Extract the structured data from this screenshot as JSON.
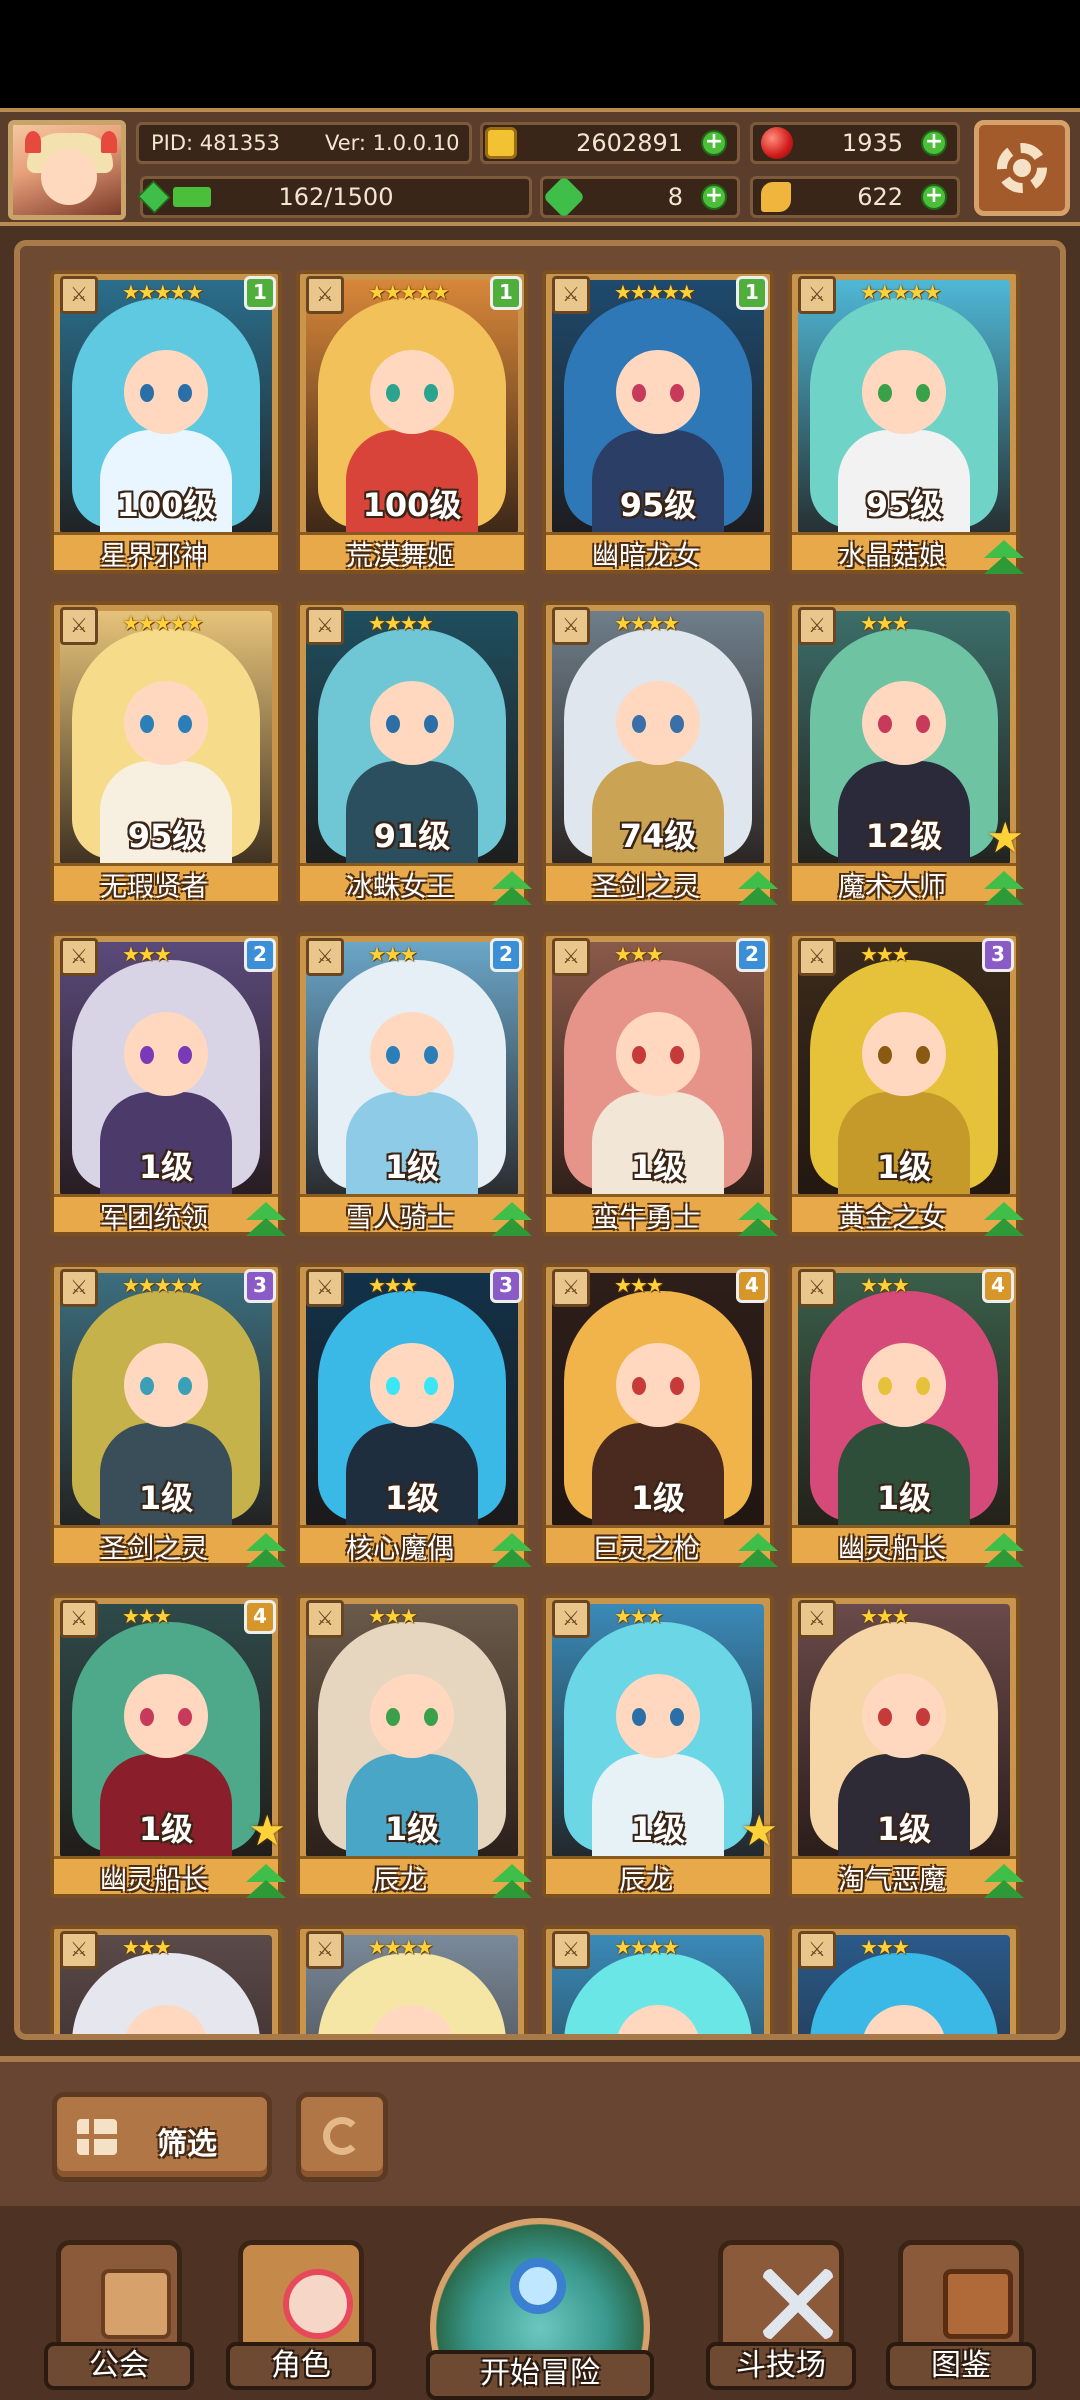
{
  "hud": {
    "pid": "PID: 481353",
    "ver": "Ver: 1.0.0.10",
    "gold": "2602891",
    "red_gem": "1935",
    "energy": "162/1500",
    "energy_fraction": 0.108,
    "clover": "8",
    "scroll": "622"
  },
  "cards": [
    {
      "name": "星界邪神",
      "level": "100级",
      "stars": "★★★★★",
      "badge": "1",
      "badge_color": "#4fae3c",
      "hair": "#5ec9e0",
      "body": "#eaf6ff",
      "bg": "#2a6e8c",
      "eye": "#2b6fa8",
      "star_icon": false,
      "up_icon": false
    },
    {
      "name": "荒漠舞姬",
      "level": "100级",
      "stars": "★★★★★",
      "badge": "1",
      "badge_color": "#4fae3c",
      "hair": "#f3c15a",
      "body": "#d8433a",
      "bg": "#d8873a",
      "eye": "#2aa48f",
      "star_icon": false,
      "up_icon": false
    },
    {
      "name": "幽暗龙女",
      "level": "95级",
      "stars": "★★★★★",
      "badge": "1",
      "badge_color": "#4fae3c",
      "hair": "#2f78b8",
      "body": "#2b3e66",
      "bg": "#1e4a6e",
      "eye": "#c73a5a",
      "star_icon": false,
      "up_icon": false
    },
    {
      "name": "水晶菇娘",
      "level": "95级",
      "stars": "★★★★★",
      "badge": "",
      "badge_color": "",
      "hair": "#6fd3c8",
      "body": "#f2f2f2",
      "bg": "#4fb8d6",
      "eye": "#3aa04a",
      "star_icon": false,
      "up_icon": true
    },
    {
      "name": "无瑕贤者",
      "level": "95级",
      "stars": "★★★★★",
      "badge": "",
      "badge_color": "",
      "hair": "#f6dc8a",
      "body": "#f7efe0",
      "bg": "#e6c37a",
      "eye": "#2b7fb8",
      "star_icon": false,
      "up_icon": false
    },
    {
      "name": "冰蛛女王",
      "level": "91级",
      "stars": "★★★★",
      "badge": "",
      "badge_color": "",
      "hair": "#6fc7d6",
      "body": "#2b4f5e",
      "bg": "#1f4e5e",
      "eye": "#2b6fa8",
      "star_icon": false,
      "up_icon": true
    },
    {
      "name": "圣剑之灵",
      "level": "74级",
      "stars": "★★★★",
      "badge": "",
      "badge_color": "",
      "hair": "#dfe6ee",
      "body": "#caa454",
      "bg": "#6e7e8a",
      "eye": "#3a6fa8",
      "star_icon": false,
      "up_icon": true
    },
    {
      "name": "魔术大师",
      "level": "12级",
      "stars": "★★★",
      "badge": "",
      "badge_color": "",
      "hair": "#6ec4a2",
      "body": "#2a2a3a",
      "bg": "#3c6e6a",
      "eye": "#c73a5a",
      "star_icon": true,
      "up_icon": true
    },
    {
      "name": "军团统领",
      "level": "1级",
      "stars": "★★★",
      "badge": "2",
      "badge_color": "#3a8fd6",
      "hair": "#d9d3e6",
      "body": "#4b3a6a",
      "bg": "#5a4a7a",
      "eye": "#7a3ab8",
      "star_icon": false,
      "up_icon": true
    },
    {
      "name": "雪人骑士",
      "level": "1级",
      "stars": "★★★",
      "badge": "2",
      "badge_color": "#3a8fd6",
      "hair": "#e6eef6",
      "body": "#8ecbe6",
      "bg": "#6aa6c8",
      "eye": "#2b7fb8",
      "star_icon": false,
      "up_icon": true
    },
    {
      "name": "蛮牛勇士",
      "level": "1级",
      "stars": "★★★",
      "badge": "2",
      "badge_color": "#3a8fd6",
      "hair": "#e6948a",
      "body": "#f2e6d6",
      "bg": "#8a5a4a",
      "eye": "#c73a3a",
      "star_icon": false,
      "up_icon": true
    },
    {
      "name": "黄金之女",
      "level": "1级",
      "stars": "★★★",
      "badge": "3",
      "badge_color": "#8a5ac6",
      "hair": "#e6c23a",
      "body": "#c69a2a",
      "bg": "#3a2a1a",
      "eye": "#8a5a12",
      "star_icon": false,
      "up_icon": true
    },
    {
      "name": "圣剑之灵",
      "level": "1级",
      "stars": "★★★★★",
      "badge": "3",
      "badge_color": "#8a5ac6",
      "hair": "#c6b24a",
      "body": "#3a4e5a",
      "bg": "#3c6e7e",
      "eye": "#3aa0b8",
      "star_icon": false,
      "up_icon": true
    },
    {
      "name": "核心魔偶",
      "level": "1级",
      "stars": "★★★",
      "badge": "3",
      "badge_color": "#8a5ac6",
      "hair": "#3ab8e6",
      "body": "#1e2e3e",
      "bg": "#12324a",
      "eye": "#3ae6f6",
      "star_icon": false,
      "up_icon": true
    },
    {
      "name": "巨灵之枪",
      "level": "1级",
      "stars": "★★★",
      "badge": "4",
      "badge_color": "#d6962a",
      "hair": "#f0b44a",
      "body": "#4a2a1e",
      "bg": "#2e1e1a",
      "eye": "#c73a3a",
      "star_icon": false,
      "up_icon": true
    },
    {
      "name": "幽灵船长",
      "level": "1级",
      "stars": "★★★",
      "badge": "4",
      "badge_color": "#d6962a",
      "hair": "#d64a7a",
      "body": "#2e4e3a",
      "bg": "#3a5e4a",
      "eye": "#e6c23a",
      "star_icon": false,
      "up_icon": true
    },
    {
      "name": "幽灵船长",
      "level": "1级",
      "stars": "★★★",
      "badge": "4",
      "badge_color": "#d6962a",
      "hair": "#4ea88a",
      "body": "#8a1e2a",
      "bg": "#2e4a4a",
      "eye": "#c73a5a",
      "star_icon": true,
      "up_icon": true
    },
    {
      "name": "辰龙",
      "level": "1级",
      "stars": "★★★",
      "badge": "",
      "badge_color": "",
      "hair": "#e6d6c0",
      "body": "#4aa6c6",
      "bg": "#6a5a4a",
      "eye": "#3aa04a",
      "star_icon": false,
      "up_icon": true
    },
    {
      "name": "辰龙",
      "level": "1级",
      "stars": "★★★",
      "badge": "",
      "badge_color": "",
      "hair": "#6ad6e6",
      "body": "#e6f2f6",
      "bg": "#3a8ab8",
      "eye": "#2b6fa8",
      "star_icon": true,
      "up_icon": false
    },
    {
      "name": "淘气恶魔",
      "level": "1级",
      "stars": "★★★",
      "badge": "",
      "badge_color": "",
      "hair": "#f6d6a6",
      "body": "#2e2a36",
      "bg": "#6a4a4a",
      "eye": "#c73a3a",
      "star_icon": false,
      "up_icon": true
    },
    {
      "name": "",
      "level": "",
      "stars": "★★★",
      "badge": "",
      "badge_color": "",
      "hair": "#e6e6ee",
      "body": "#c6a6a6",
      "bg": "#5a4a4a",
      "eye": "#c73a3a",
      "star_icon": false,
      "up_icon": false
    },
    {
      "name": "",
      "level": "",
      "stars": "★★★★",
      "badge": "",
      "badge_color": "",
      "hair": "#f6e6a6",
      "body": "#e6e6e6",
      "bg": "#7a8a9a",
      "eye": "#3aa04a",
      "star_icon": false,
      "up_icon": false
    },
    {
      "name": "",
      "level": "",
      "stars": "★★★★",
      "badge": "",
      "badge_color": "",
      "hair": "#6ae6e6",
      "body": "#3ab8c6",
      "bg": "#3a8ab8",
      "eye": "#c73a8a",
      "star_icon": false,
      "up_icon": false
    },
    {
      "name": "",
      "level": "",
      "stars": "★★★",
      "badge": "",
      "badge_color": "",
      "hair": "#3ab8e6",
      "body": "#6ae6f6",
      "bg": "#2a5a8a",
      "eye": "#3ab8e6",
      "star_icon": false,
      "up_icon": false
    }
  ],
  "filter": {
    "label": "筛选"
  },
  "nav": {
    "guild": "公会",
    "role": "角色",
    "adventure": "开始冒险",
    "arena": "斗技场",
    "codex": "图鉴"
  }
}
